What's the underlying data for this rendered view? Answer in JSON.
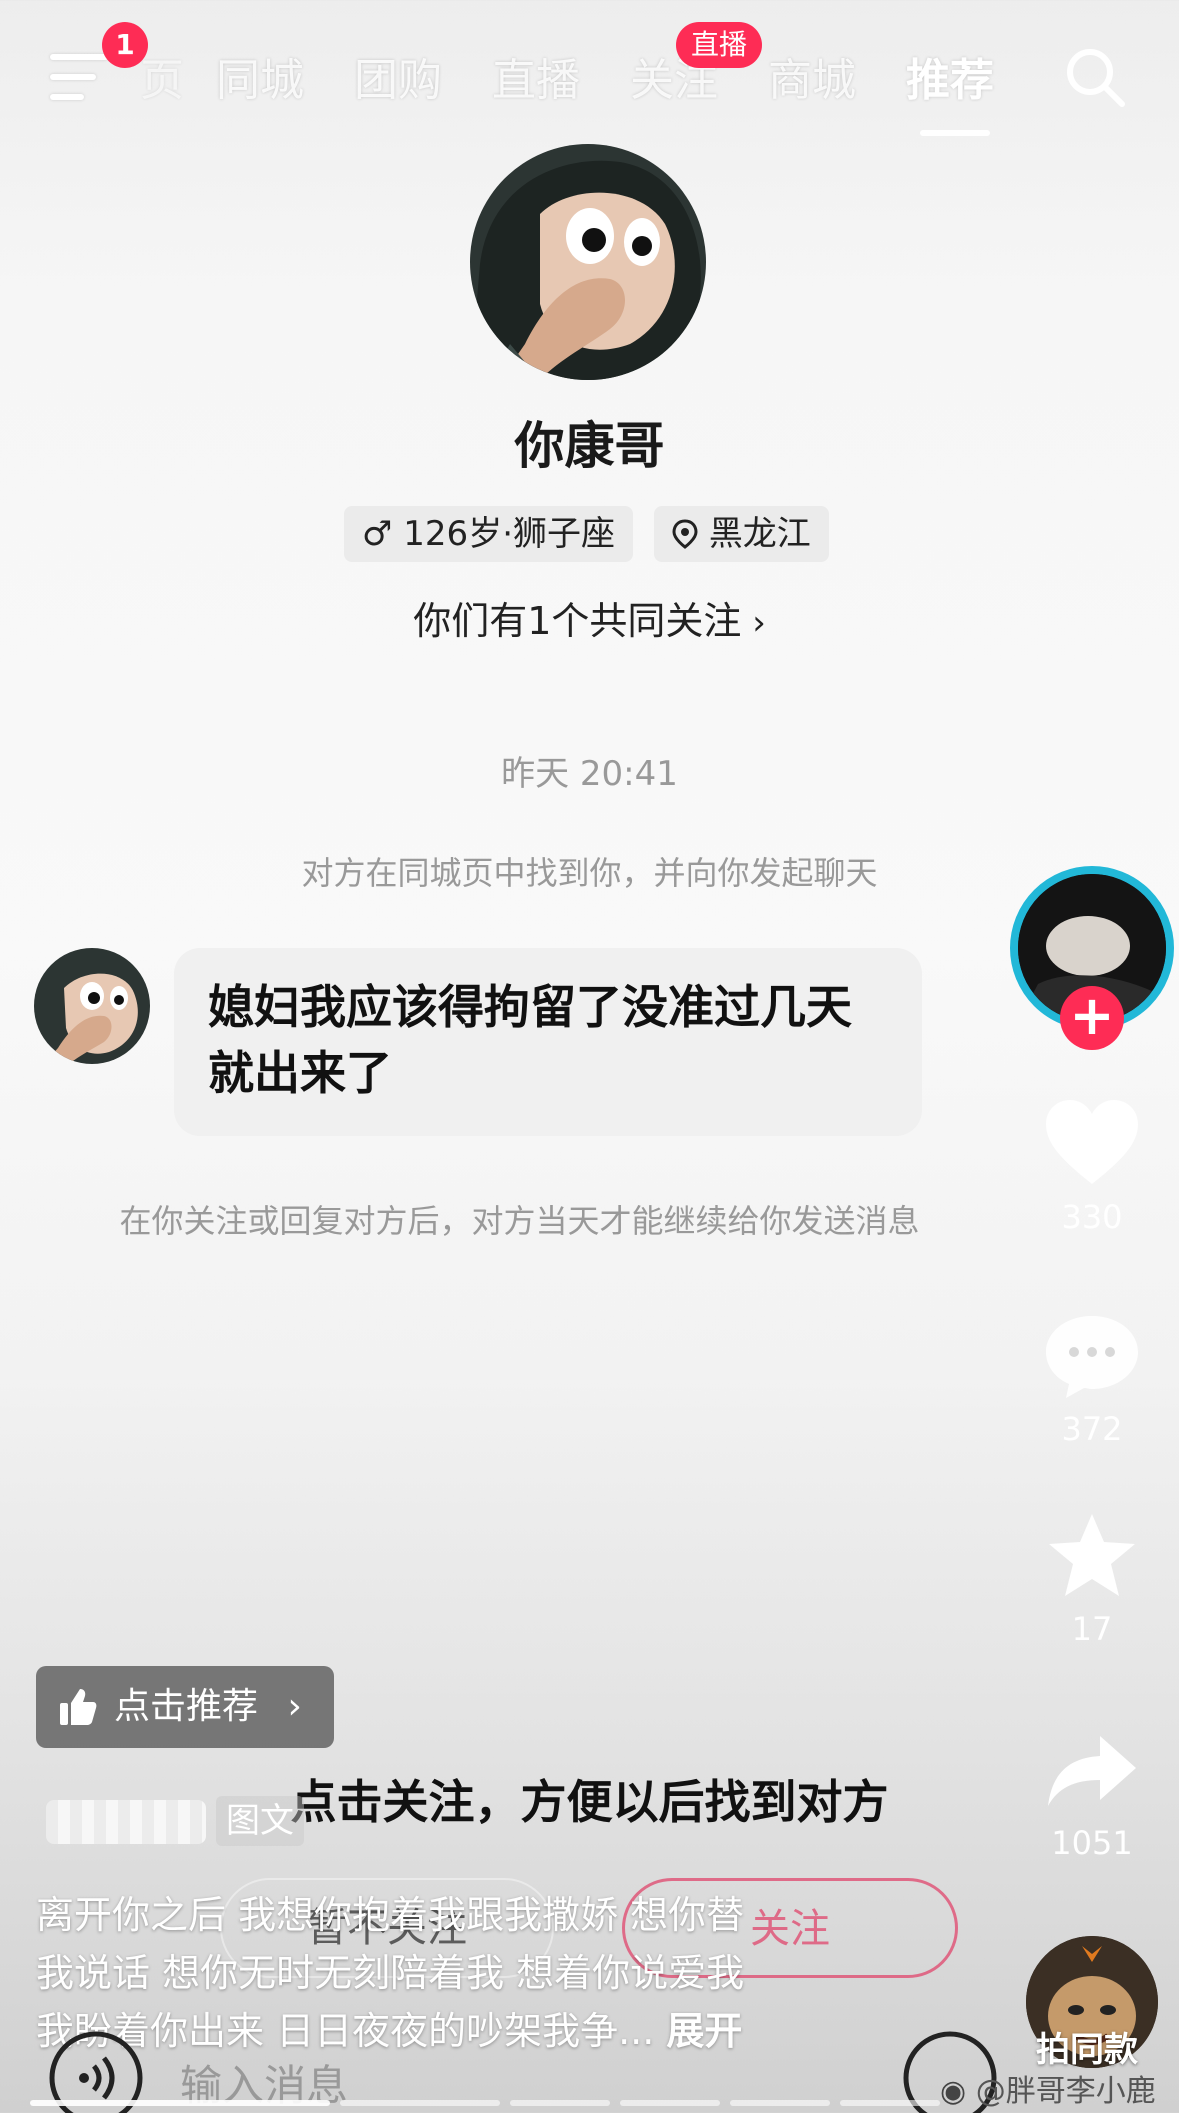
{
  "topnav": {
    "notification_count": "1",
    "tabs": [
      "页",
      "同城",
      "团购",
      "直播",
      "关注",
      "商城",
      "推荐"
    ],
    "live_badge": "直播"
  },
  "profile": {
    "name": "你康哥",
    "age_zodiac": "126岁·狮子座",
    "location": "黑龙江",
    "mutual": "你们有1个共同关注"
  },
  "chat": {
    "timestamp": "昨天 20:41",
    "system_note_top": "对方在同城页中找到你，并向你发起聊天",
    "message_line1": "媳妇我应该得拘留了没准过几天",
    "message_line2": "就出来了",
    "system_note_bottom": "在你关注或回复对方后，对方当天才能继续给你发送消息"
  },
  "sidebar": {
    "likes": "330",
    "comments": "372",
    "favorites": "17",
    "shares": "1051",
    "same_style": "拍同款"
  },
  "overlay": {
    "recommend": "点击推荐",
    "follow_prompt": "点击关注，方便以后找到对方",
    "not_follow": "暂不关注",
    "follow": "关注",
    "post_type": "图文"
  },
  "caption": {
    "text_line1": "离开你之后 我想你抱着我跟我撒娇 想你替",
    "text_line2": "我说话 想你无时无刻陪着我 想着你说爱我",
    "text_line3": "我盼着你出来 日日夜夜的吵架我争... ",
    "expand": "展开"
  },
  "bottom": {
    "input_placeholder": "输入消息",
    "watermark": "@胖哥李小鹿"
  },
  "colors": {
    "accent": "#fe2c55",
    "ring": "#22b8d8"
  }
}
